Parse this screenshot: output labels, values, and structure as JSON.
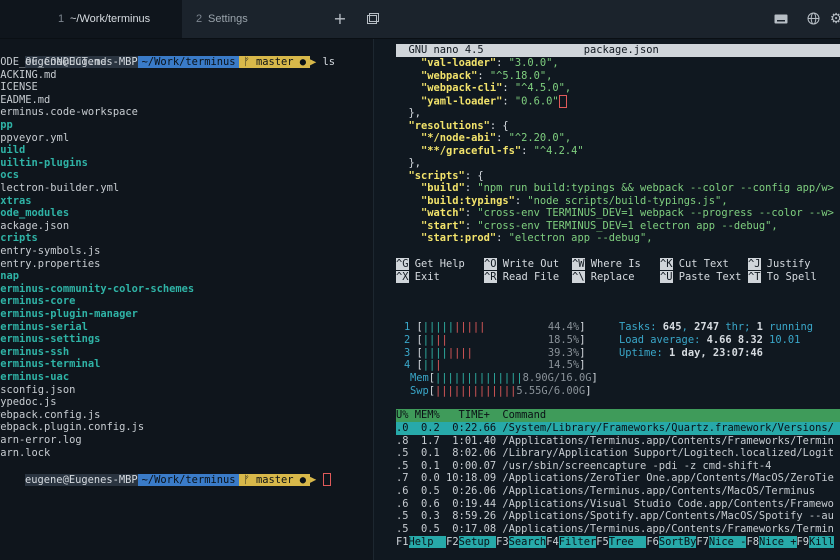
{
  "window": {
    "tabs": [
      {
        "num": "1",
        "title": "~/Work/terminus"
      },
      {
        "num": "2",
        "title": "Settings"
      }
    ],
    "icons": [
      "close-dot",
      "minimize-dot",
      "zoom-dot",
      "plus-icon",
      "split-window-icon",
      "keyboard-icon",
      "globe-icon",
      "gear-icon"
    ]
  },
  "left": {
    "prompt1": {
      "user": "eugene@Eugenes-MBP",
      "path": "~/Work/terminus",
      "branch": "ᚠ master ●",
      "cmd": "ls"
    },
    "listing": [
      {
        "t": "CODE_OF_CONDUCT.md",
        "d": false
      },
      {
        "t": "HACKING.md",
        "d": false
      },
      {
        "t": "LICENSE",
        "d": false
      },
      {
        "t": "README.md",
        "d": false
      },
      {
        "t": "terminus.code-workspace",
        "d": false
      },
      {
        "t": "app",
        "d": true
      },
      {
        "t": "appveyor.yml",
        "d": false
      },
      {
        "t": "build",
        "d": true
      },
      {
        "t": "builtin-plugins",
        "d": true
      },
      {
        "t": "docs",
        "d": true
      },
      {
        "t": "electron-builder.yml",
        "d": false
      },
      {
        "t": "extras",
        "d": true
      },
      {
        "t": "node_modules",
        "d": true
      },
      {
        "t": "package.json",
        "d": false
      },
      {
        "t": "scripts",
        "d": true
      },
      {
        "t": "sentry-symbols.js",
        "d": false
      },
      {
        "t": "sentry.properties",
        "d": false
      },
      {
        "t": "snap",
        "d": true
      },
      {
        "t": "terminus-community-color-schemes",
        "d": true
      },
      {
        "t": "terminus-core",
        "d": true
      },
      {
        "t": "terminus-plugin-manager",
        "d": true
      },
      {
        "t": "terminus-serial",
        "d": true
      },
      {
        "t": "terminus-settings",
        "d": true
      },
      {
        "t": "terminus-ssh",
        "d": true
      },
      {
        "t": "terminus-terminal",
        "d": true
      },
      {
        "t": "terminus-uac",
        "d": true
      },
      {
        "t": "tsconfig.json",
        "d": false
      },
      {
        "t": "typedoc.js",
        "d": false
      },
      {
        "t": "webpack.config.js",
        "d": false
      },
      {
        "t": "webpack.plugin.config.js",
        "d": false
      },
      {
        "t": "yarn-error.log",
        "d": false
      },
      {
        "t": "yarn.lock",
        "d": false
      }
    ],
    "prompt2": {
      "user": "eugene@Eugenes-MBP",
      "path": "~/Work/terminus",
      "branch": "ᚠ master ●"
    }
  },
  "nano": {
    "version": "GNU nano 4.5",
    "file": "package.json",
    "lines": [
      {
        "i": "    ",
        "k": "\"val-loader\"",
        "v": ": \"3.0.0\","
      },
      {
        "i": "    ",
        "k": "\"webpack\"",
        "v": ": \"^5.18.0\","
      },
      {
        "i": "    ",
        "k": "\"webpack-cli\"",
        "v": ": \"^4.5.0\","
      },
      {
        "i": "    ",
        "k": "\"yaml-loader\"",
        "v": ": \"0.6.0\"",
        "cursor": true
      },
      {
        "i": "  ",
        "k": "",
        "v": "},"
      },
      {
        "i": "  ",
        "k": "\"resolutions\"",
        "v": ": {"
      },
      {
        "i": "    ",
        "k": "\"*/node-abi\"",
        "v": ": \"^2.20.0\","
      },
      {
        "i": "    ",
        "k": "\"**/graceful-fs\"",
        "v": ": \"^4.2.4\""
      },
      {
        "i": "  ",
        "k": "",
        "v": "},"
      },
      {
        "i": "  ",
        "k": "\"scripts\"",
        "v": ": {"
      },
      {
        "i": "    ",
        "k": "\"build\"",
        "v": ": \"npm run build:typings && webpack --color --config app/w>"
      },
      {
        "i": "    ",
        "k": "\"build:typings\"",
        "v": ": \"node scripts/build-typings.js\","
      },
      {
        "i": "    ",
        "k": "\"watch\"",
        "v": ": \"cross-env TERMINUS_DEV=1 webpack --progress --color --w>"
      },
      {
        "i": "    ",
        "k": "\"start\"",
        "v": ": \"cross-env TERMINUS_DEV=1 electron app --debug\","
      },
      {
        "i": "    ",
        "k": "\"start:prod\"",
        "v": ": \"electron app --debug\","
      }
    ],
    "shortcuts": [
      [
        {
          "k": "^G",
          "l": "Get Help"
        },
        {
          "k": "^O",
          "l": "Write Out"
        },
        {
          "k": "^W",
          "l": "Where Is"
        },
        {
          "k": "^K",
          "l": "Cut Text"
        },
        {
          "k": "^J",
          "l": "Justify"
        }
      ],
      [
        {
          "k": "^X",
          "l": "Exit"
        },
        {
          "k": "^R",
          "l": "Read File"
        },
        {
          "k": "^\\",
          "l": "Replace"
        },
        {
          "k": "^U",
          "l": "Paste Text"
        },
        {
          "k": "^T",
          "l": "To Spell"
        }
      ]
    ]
  },
  "htop": {
    "cpus": [
      {
        "n": "1",
        "bar": "||||||||||",
        "pct": "44.4%"
      },
      {
        "n": "2",
        "bar": "||||",
        "pct": "18.5%"
      },
      {
        "n": "3",
        "bar": "||||||||",
        "pct": "39.3%"
      },
      {
        "n": "4",
        "bar": "|||",
        "pct": "14.5%"
      }
    ],
    "mem": {
      "label": "Mem",
      "bar": "||||||||||||||",
      "val": "8.90G/16.0G"
    },
    "swp": {
      "label": "Swp",
      "bar": "|||||||||||||",
      "val": "5.55G/6.00G"
    },
    "tasks_label": "Tasks:",
    "tasks": "645",
    "thr": "2747",
    "thr_label": "thr;",
    "running": "1",
    "running_label": "running",
    "load_label": "Load average:",
    "load1": "4.66",
    "load5": "8.32",
    "load15": "10.01",
    "uptime_label": "Uptime:",
    "uptime": "1 day, 23:07:46",
    "header": "U% MEM%   TIME+  Command",
    "rows": [
      ".0  0.2  0:22.66 /System/Library/Frameworks/Quartz.framework/Versions/",
      ".8  1.7  1:01.40 /Applications/Terminus.app/Contents/Frameworks/Termin",
      ".5  0.1  8:02.06 /Library/Application Support/Logitech.localized/Logit",
      ".5  0.1  0:00.07 /usr/sbin/screencapture -pdi -z cmd-shift-4",
      ".7  0.0 10:18.09 /Applications/ZeroTier One.app/Contents/MacOS/ZeroTie",
      ".6  0.5  0:26.06 /Applications/Terminus.app/Contents/MacOS/Terminus",
      ".6  0.6  0:19.44 /Applications/Visual Studio Code.app/Contents/Framewo",
      ".5  0.3  8:59.26 /Applications/Spotify.app/Contents/MacOS/Spotify --au",
      ".5  0.5  0:17.08 /Applications/Terminus.app/Contents/Frameworks/Termin"
    ],
    "fkeys": [
      {
        "k": "F1",
        "l": "Help  "
      },
      {
        "k": "F2",
        "l": "Setup "
      },
      {
        "k": "F3",
        "l": "Search"
      },
      {
        "k": "F4",
        "l": "Filter"
      },
      {
        "k": "F5",
        "l": "Tree  "
      },
      {
        "k": "F6",
        "l": "SortBy"
      },
      {
        "k": "F7",
        "l": "Nice -"
      },
      {
        "k": "F8",
        "l": "Nice +"
      },
      {
        "k": "F9",
        "l": "Kill"
      }
    ]
  },
  "colors": {
    "accent_teal": "#2fb3a6",
    "prompt_yellow": "#d8b84a",
    "path_blue": "#3a7bc8",
    "htop_green": "#3f9b5a"
  }
}
